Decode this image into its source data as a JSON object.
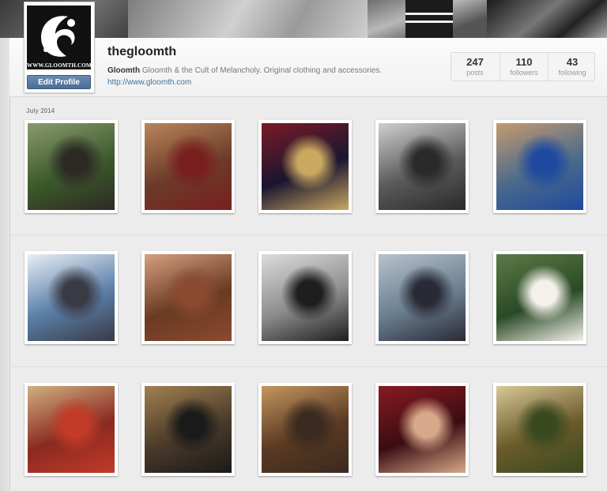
{
  "profile": {
    "username": "thegloomth",
    "full_name": "Gloomth",
    "bio": "Gloomth & the Cult of Melancholy. Original clothing and accessories.",
    "website": "http://www.gloomth.com",
    "avatar_text": "WWW.GLOOMTH.COM",
    "edit_button": "Edit Profile"
  },
  "stats": {
    "posts": {
      "value": "247",
      "label": "posts"
    },
    "followers": {
      "value": "110",
      "label": "followers"
    },
    "following": {
      "value": "43",
      "label": "following"
    }
  },
  "feed": {
    "section_label": "July 2014",
    "photos": [
      {
        "name": "photo-garden-gate-girl",
        "colors": [
          "#3c5a2a",
          "#8a9a70",
          "#2d2a26"
        ]
      },
      {
        "name": "photo-teddy-bear-cape",
        "colors": [
          "#6b3b2a",
          "#b8865a",
          "#7a1f1f"
        ]
      },
      {
        "name": "photo-woman-velvet-coat",
        "colors": [
          "#1a1530",
          "#7a1b26",
          "#c9a860"
        ]
      },
      {
        "name": "photo-carousel-bw",
        "colors": [
          "#5a5a5a",
          "#cfcfcf",
          "#2a2a2a"
        ]
      },
      {
        "name": "photo-cat-in-cage",
        "colors": [
          "#4a6a8a",
          "#c49a70",
          "#1f4aa0"
        ]
      },
      {
        "name": "photo-ferris-wheel-sky",
        "colors": [
          "#5a7fa8",
          "#e9eef4",
          "#3a3a44"
        ]
      },
      {
        "name": "photo-selfie-face",
        "colors": [
          "#6a3a22",
          "#d6a080",
          "#8a4a30"
        ]
      },
      {
        "name": "photo-umbrella-bw",
        "colors": [
          "#8c8c8c",
          "#dcdcdc",
          "#1e1e1e"
        ]
      },
      {
        "name": "photo-girl-at-lake",
        "colors": [
          "#6a7e90",
          "#b7c3cd",
          "#2a2a36"
        ]
      },
      {
        "name": "photo-ghost-in-leaves",
        "colors": [
          "#2a4a26",
          "#5c7a48",
          "#f4f1ea"
        ]
      },
      {
        "name": "photo-cult-banner-print",
        "colors": [
          "#8a2a20",
          "#d0b080",
          "#c23a28"
        ]
      },
      {
        "name": "photo-cat-and-bear",
        "colors": [
          "#4a3a2a",
          "#a08050",
          "#1a1a1a"
        ]
      },
      {
        "name": "photo-teddy-bear-bench",
        "colors": [
          "#5a3a22",
          "#c49660",
          "#3a2a20"
        ]
      },
      {
        "name": "photo-girl-reading-curtain",
        "colors": [
          "#3a0d12",
          "#8a1a22",
          "#d9a88a"
        ]
      },
      {
        "name": "photo-vintage-paper-flowers",
        "colors": [
          "#6a5a2a",
          "#d8c898",
          "#3a4a20"
        ]
      }
    ]
  }
}
